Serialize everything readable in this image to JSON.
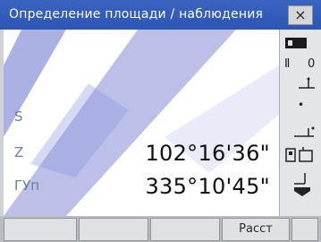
{
  "window": {
    "title": "Определение площади / наблюдения",
    "close_glyph": "×"
  },
  "measurements": [
    {
      "label": "S",
      "value": ""
    },
    {
      "label": "Z",
      "value": "102°16'36\""
    },
    {
      "label": "ГУп",
      "value": "335°10'45\""
    }
  ],
  "side_status": {
    "battery": "battery-icon",
    "target": "target-icon",
    "prism_constant": "0",
    "tilt": "tilt-icon",
    "horizontal": "horizontal-icon",
    "memory": "memory-icon",
    "signal": "signal-icon"
  },
  "softkeys": {
    "f1": "",
    "f2": "",
    "f3": "",
    "f4": "Расст"
  },
  "colors": {
    "titlebar": "#2c55b4",
    "watermark": "#5566c8",
    "label": "#6a7fa3"
  }
}
